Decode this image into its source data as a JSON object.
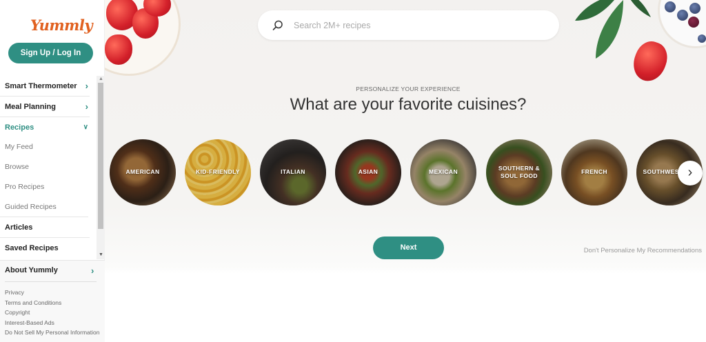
{
  "brand": {
    "logo_text": "Yummly",
    "accent": "#2f8f83",
    "logo_color": "#e16120"
  },
  "sidebar": {
    "signup_label": "Sign Up / Log In",
    "items": [
      {
        "label": "Smart Thermometer",
        "kind": "main",
        "chevron": "chevron-right-icon"
      },
      {
        "label": "Meal Planning",
        "kind": "main",
        "chevron": "chevron-right-icon"
      },
      {
        "label": "Recipes",
        "kind": "main",
        "chevron": "chevron-down-icon",
        "active": true
      },
      {
        "label": "My Feed",
        "kind": "sub"
      },
      {
        "label": "Browse",
        "kind": "sub"
      },
      {
        "label": "Pro Recipes",
        "kind": "sub"
      },
      {
        "label": "Guided Recipes",
        "kind": "sub"
      },
      {
        "label": "Articles",
        "kind": "main"
      },
      {
        "label": "Saved Recipes",
        "kind": "main"
      }
    ],
    "about_label": "About Yummly",
    "footer_links": [
      "Privacy",
      "Terms and Conditions",
      "Copyright",
      "Interest-Based Ads",
      "Do Not Sell My Personal Information"
    ]
  },
  "search": {
    "placeholder": "Search 2M+ recipes"
  },
  "main": {
    "eyebrow": "PERSONALIZE YOUR EXPERIENCE",
    "headline": "What are your favorite cuisines?",
    "cuisines": [
      {
        "label": "AMERICAN"
      },
      {
        "label": "KID-FRIENDLY"
      },
      {
        "label": "ITALIAN"
      },
      {
        "label": "ASIAN"
      },
      {
        "label": "MEXICAN"
      },
      {
        "label": "SOUTHERN & SOUL FOOD"
      },
      {
        "label": "FRENCH"
      },
      {
        "label": "SOUTHWESTERN"
      }
    ],
    "next_label": "Next",
    "skip_label": "Don't Personalize My Recommendations"
  }
}
